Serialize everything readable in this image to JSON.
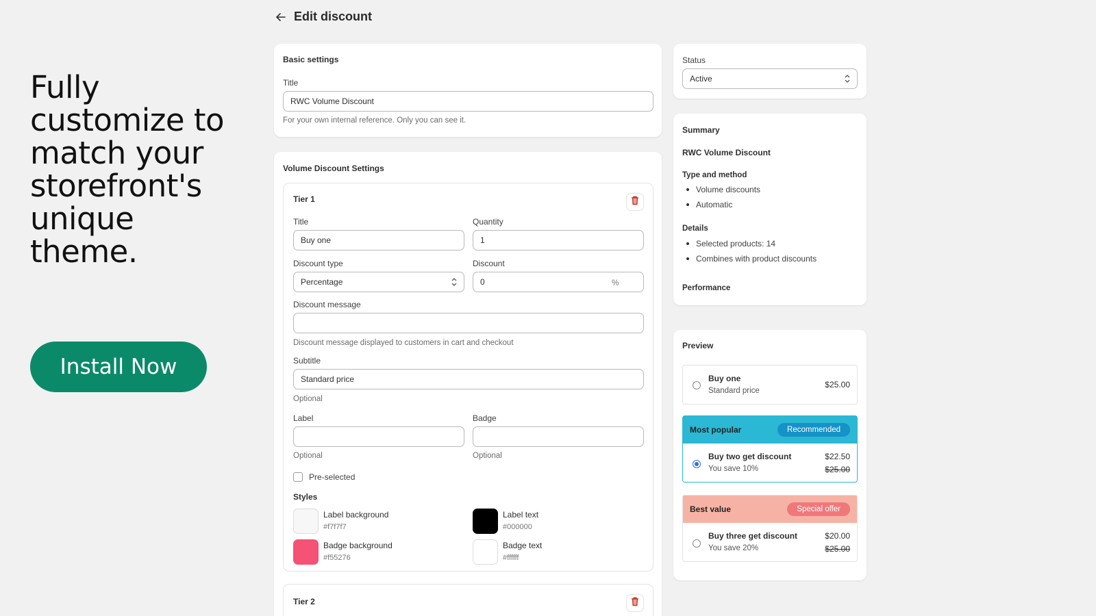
{
  "promo": {
    "heading": "Fully customize to match your storefront's unique theme.",
    "install_label": "Install Now",
    "accent": "#0b8a6a"
  },
  "header": {
    "back_icon": "arrow-left-icon",
    "title": "Edit discount"
  },
  "basic_settings": {
    "heading": "Basic settings",
    "title_label": "Title",
    "title_value": "RWC Volume Discount",
    "title_help": "For your own internal reference. Only you can see it."
  },
  "volume_settings": {
    "heading": "Volume Discount Settings",
    "tier1": {
      "heading": "Tier 1",
      "delete_icon": "trash-icon",
      "title_label": "Title",
      "title_value": "Buy one",
      "quantity_label": "Quantity",
      "quantity_value": "1",
      "discount_type_label": "Discount type",
      "discount_type_value": "Percentage",
      "discount_label": "Discount",
      "discount_value": "0",
      "discount_suffix": "%",
      "message_label": "Discount message",
      "message_value": "",
      "message_help": "Discount message displayed to customers in cart and checkout",
      "subtitle_label": "Subtitle",
      "subtitle_value": "Standard price",
      "subtitle_help": "Optional",
      "label_label": "Label",
      "label_value": "",
      "label_help": "Optional",
      "badge_label": "Badge",
      "badge_value": "",
      "badge_help": "Optional",
      "preselected_label": "Pre-selected",
      "preselected_checked": false,
      "styles_heading": "Styles",
      "styles": [
        {
          "name": "Label background",
          "hex": "#f7f7f7",
          "color": "#f7f7f7"
        },
        {
          "name": "Label text",
          "hex": "#000000",
          "color": "#000000"
        },
        {
          "name": "Badge background",
          "hex": "#f55276",
          "color": "#f55276"
        },
        {
          "name": "Badge text",
          "hex": "#ffffff",
          "color": "#ffffff"
        }
      ]
    },
    "tier2": {
      "heading": "Tier 2",
      "delete_icon": "trash-icon"
    }
  },
  "status": {
    "label": "Status",
    "value": "Active"
  },
  "summary": {
    "heading": "Summary",
    "name": "RWC Volume Discount",
    "type_heading": "Type and method",
    "type_items": [
      "Volume discounts",
      "Automatic"
    ],
    "details_heading": "Details",
    "details_items": [
      "Selected products: 14",
      "Combines with product discounts"
    ],
    "performance_heading": "Performance"
  },
  "preview": {
    "heading": "Preview",
    "options": [
      {
        "title": "Buy one",
        "subtitle": "Standard price",
        "price": "$25.00",
        "selected": false
      },
      {
        "band_label": "Most popular",
        "band_badge": "Recommended",
        "band_color": "#2bb8d4",
        "badge_color": "#1592c7",
        "title": "Buy two get discount",
        "subtitle": "You save 10%",
        "price": "$22.50",
        "compare_price": "$25.00",
        "selected": true
      },
      {
        "band_label": "Best value",
        "band_badge": "Special offer",
        "band_color": "#f6b3a5",
        "badge_color": "#f0787a",
        "title": "Buy three get discount",
        "subtitle": "You save 20%",
        "price": "$20.00",
        "compare_price": "$25.00",
        "selected": false
      }
    ]
  }
}
